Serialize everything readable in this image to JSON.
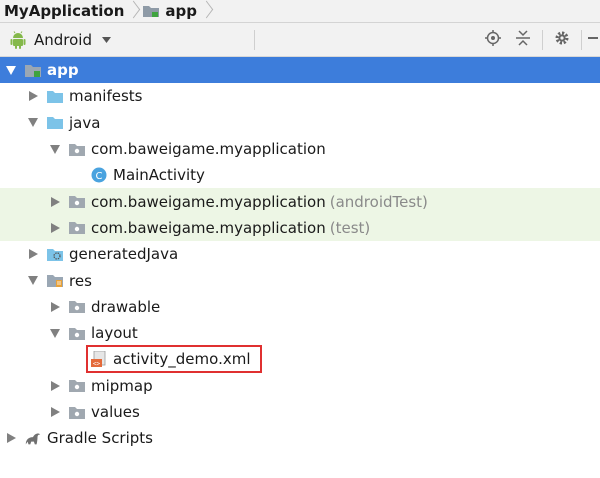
{
  "breadcrumb": {
    "project": "MyApplication",
    "module": "app"
  },
  "toolbar": {
    "view_mode": "Android",
    "buttons": [
      "locate-icon",
      "collapse-icon",
      "gear-icon"
    ]
  },
  "tree": [
    {
      "label": "app",
      "level": 0,
      "expanded": true,
      "selected": true,
      "icon": "module-folder-icon"
    },
    {
      "label": "manifests",
      "level": 1,
      "expanded": false,
      "icon": "folder-icon"
    },
    {
      "label": "java",
      "level": 1,
      "expanded": true,
      "icon": "folder-icon"
    },
    {
      "label": "com.baweigame.myapplication",
      "level": 2,
      "expanded": true,
      "icon": "package-icon"
    },
    {
      "label": "MainActivity",
      "level": 3,
      "leaf": true,
      "icon": "class-icon"
    },
    {
      "label": "com.baweigame.myapplication",
      "suffix": "(androidTest)",
      "level": 2,
      "expanded": false,
      "icon": "package-icon"
    },
    {
      "label": "com.baweigame.myapplication",
      "suffix": "(test)",
      "level": 2,
      "expanded": false,
      "icon": "package-icon"
    },
    {
      "label": "generatedJava",
      "level": 1,
      "expanded": false,
      "icon": "generated-folder-icon"
    },
    {
      "label": "res",
      "level": 1,
      "expanded": true,
      "icon": "res-folder-icon"
    },
    {
      "label": "drawable",
      "level": 2,
      "expanded": false,
      "icon": "package-icon"
    },
    {
      "label": "layout",
      "level": 2,
      "expanded": true,
      "icon": "package-icon"
    },
    {
      "label": "activity_demo.xml",
      "level": 3,
      "leaf": true,
      "icon": "xml-layout-icon",
      "highlighted": true
    },
    {
      "label": "mipmap",
      "level": 2,
      "expanded": false,
      "icon": "package-icon"
    },
    {
      "label": "values",
      "level": 2,
      "expanded": false,
      "icon": "package-icon"
    },
    {
      "label": "Gradle Scripts",
      "level": 0,
      "expanded": false,
      "icon": "gradle-icon"
    }
  ],
  "colors": {
    "selection": "#3d7ddb",
    "test_background": "#edf6e5",
    "highlight_box": "#e03030"
  }
}
